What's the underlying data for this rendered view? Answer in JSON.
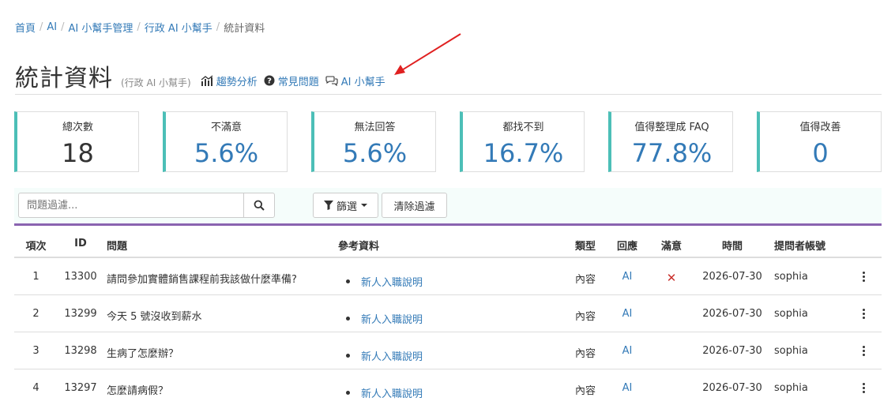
{
  "breadcrumb": [
    "首頁",
    "AI",
    "AI 小幫手管理",
    "行政 AI 小幫手",
    "統計資料"
  ],
  "header": {
    "title": "統計資料",
    "subtitle": "(行政 AI 小幫手)",
    "links": {
      "trend": "趨勢分析",
      "faq": "常見問題",
      "assistant": "AI 小幫手"
    }
  },
  "stats": [
    {
      "label": "總次數",
      "value": "18"
    },
    {
      "label": "不滿意",
      "value": "5.6%"
    },
    {
      "label": "無法回答",
      "value": "5.6%"
    },
    {
      "label": "都找不到",
      "value": "16.7%"
    },
    {
      "label": "值得整理成 FAQ",
      "value": "77.8%"
    },
    {
      "label": "值得改善",
      "value": "0"
    }
  ],
  "filters": {
    "search_placeholder": "問題過濾...",
    "filter_label": "篩選",
    "clear_label": "清除過濾"
  },
  "table": {
    "columns": {
      "no": "項次",
      "id": "ID",
      "question": "問題",
      "reference": "參考資料",
      "type": "類型",
      "response": "回應",
      "satisfaction": "滿意",
      "time": "時間",
      "user": "提問者帳號"
    },
    "rows": [
      {
        "no": "1",
        "id": "13300",
        "question": "請問參加實體銷售課程前我該做什麼準備?",
        "reference": "新人入職說明",
        "type": "內容",
        "response": "AI",
        "satisfaction": "✕",
        "time": "2026-07-30",
        "user": "sophia"
      },
      {
        "no": "2",
        "id": "13299",
        "question": "今天 5 號沒收到薪水",
        "reference": "新人入職說明",
        "type": "內容",
        "response": "AI",
        "satisfaction": "",
        "time": "2026-07-30",
        "user": "sophia"
      },
      {
        "no": "3",
        "id": "13298",
        "question": "生病了怎麼辦？",
        "reference": "新人入職說明",
        "type": "內容",
        "response": "AI",
        "satisfaction": "",
        "time": "2026-07-30",
        "user": "sophia"
      },
      {
        "no": "4",
        "id": "13297",
        "question": "怎麼請病假？",
        "reference": "新人入職說明",
        "type": "內容",
        "response": "AI",
        "satisfaction": "",
        "time": "2026-07-30",
        "user": "sophia"
      }
    ]
  },
  "colors": {
    "link": "#337ab7",
    "accent_teal": "#4cbfb7",
    "accent_purple": "#8a63b0",
    "error_red": "#c9302c",
    "annotation_arrow": "#e02020"
  }
}
